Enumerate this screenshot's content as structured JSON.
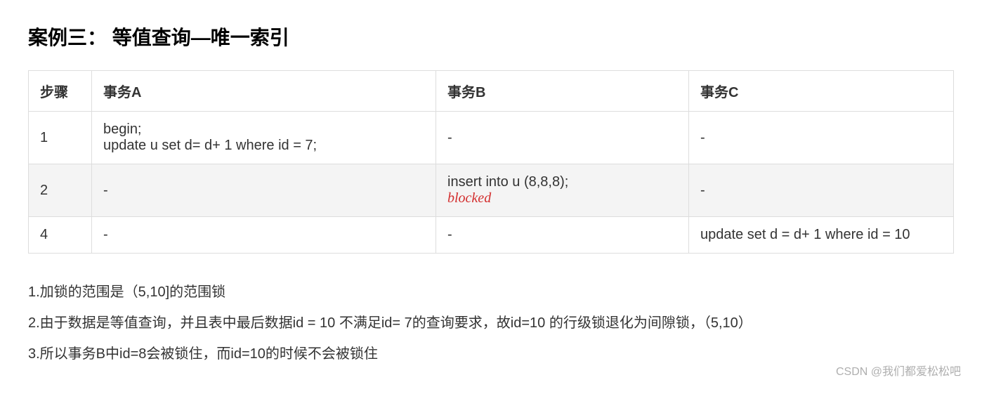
{
  "title": "案例三： 等值查询—唯一索引",
  "table": {
    "headers": {
      "step": "步骤",
      "txA": "事务A",
      "txB": "事务B",
      "txC": "事务C"
    },
    "rows": [
      {
        "step": "1",
        "a_line1": "begin;",
        "a_line2": "update u set d= d+ 1 where id = 7;",
        "b": "-",
        "c": "-"
      },
      {
        "step": "2",
        "a": "-",
        "b_line1": "insert into u (8,8,8);",
        "b_blocked": "blocked",
        "c": "-"
      },
      {
        "step": "4",
        "a": "-",
        "b": "-",
        "c": "update set d = d+ 1 where id = 10"
      }
    ]
  },
  "notes": {
    "n1": "1.加锁的范围是（5,10]的范围锁",
    "n2": "2.由于数据是等值查询，并且表中最后数据id = 10 不满足id= 7的查询要求，故id=10 的行级锁退化为间隙锁，（5,10）",
    "n3": "3.所以事务B中id=8会被锁住，而id=10的时候不会被锁住"
  },
  "watermark": "CSDN @我们都爱松松吧"
}
